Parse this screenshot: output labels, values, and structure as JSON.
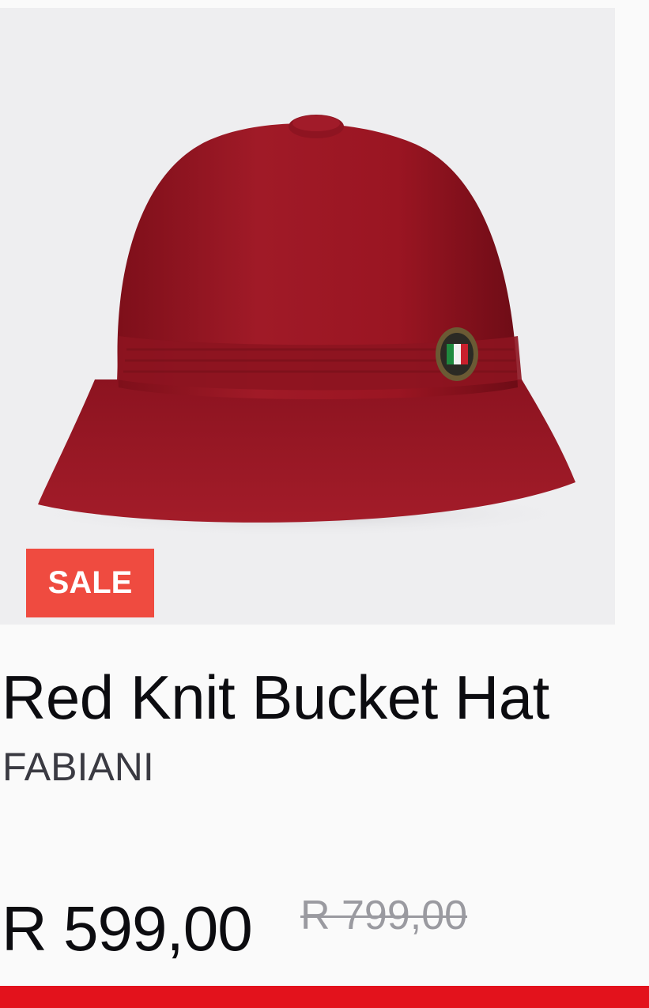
{
  "product": {
    "title": "Red Knit Bucket Hat",
    "brand": "FABIANI",
    "badge": "SALE",
    "price_current": "R 599,00",
    "price_original": "R 799,00",
    "image_alt": "Red knit bucket hat"
  },
  "colors": {
    "badge_background": "#ef4b40",
    "accent_bar": "#e3121c",
    "hat": "#9a1522",
    "image_background": "#eeeef0"
  }
}
